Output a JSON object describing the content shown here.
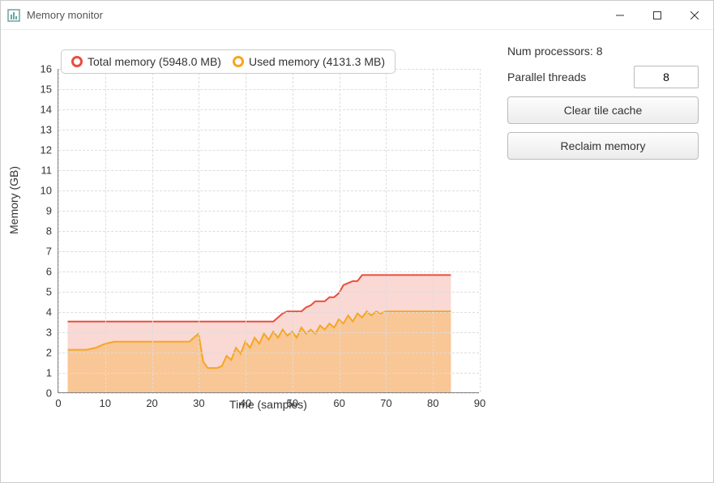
{
  "window": {
    "title": "Memory monitor"
  },
  "legend": {
    "total_label": "Total memory (5948.0 MB)",
    "used_label": "Used memory (4131.3 MB)"
  },
  "axes": {
    "ylabel": "Memory (GB)",
    "xlabel": "Time (samples)"
  },
  "side": {
    "num_processors_label": "Num processors: 8",
    "parallel_threads_label": "Parallel threads",
    "parallel_threads_value": "8",
    "clear_cache_label": "Clear tile cache",
    "reclaim_label": "Reclaim memory"
  },
  "chart_data": {
    "type": "area",
    "xlabel": "Time (samples)",
    "ylabel": "Memory (GB)",
    "xlim": [
      0,
      90
    ],
    "ylim": [
      0,
      16
    ],
    "xticks": [
      0,
      10,
      20,
      30,
      40,
      50,
      60,
      70,
      80,
      90
    ],
    "yticks": [
      0,
      1,
      2,
      3,
      4,
      5,
      6,
      7,
      8,
      9,
      10,
      11,
      12,
      13,
      14,
      15,
      16
    ],
    "x": [
      2,
      4,
      6,
      8,
      10,
      12,
      14,
      16,
      18,
      20,
      22,
      24,
      26,
      28,
      30,
      31,
      32,
      33,
      34,
      35,
      36,
      37,
      38,
      39,
      40,
      41,
      42,
      43,
      44,
      45,
      46,
      47,
      48,
      49,
      50,
      51,
      52,
      53,
      54,
      55,
      56,
      57,
      58,
      59,
      60,
      61,
      62,
      63,
      64,
      65,
      66,
      67,
      68,
      69,
      70,
      71,
      72,
      73,
      74,
      75,
      76,
      77,
      78,
      79,
      80,
      81,
      82,
      83,
      84
    ],
    "series": [
      {
        "name": "Total memory",
        "color": "#e94e3c",
        "values": [
          3.5,
          3.5,
          3.5,
          3.5,
          3.5,
          3.5,
          3.5,
          3.5,
          3.5,
          3.5,
          3.5,
          3.5,
          3.5,
          3.5,
          3.5,
          3.5,
          3.5,
          3.5,
          3.5,
          3.5,
          3.5,
          3.5,
          3.5,
          3.5,
          3.5,
          3.5,
          3.5,
          3.5,
          3.5,
          3.5,
          3.5,
          3.7,
          3.9,
          4.0,
          4.0,
          4.0,
          4.0,
          4.2,
          4.3,
          4.5,
          4.5,
          4.5,
          4.7,
          4.7,
          4.9,
          5.3,
          5.4,
          5.5,
          5.5,
          5.8,
          5.8,
          5.8,
          5.8,
          5.8,
          5.8,
          5.8,
          5.8,
          5.8,
          5.8,
          5.8,
          5.8,
          5.8,
          5.8,
          5.8,
          5.8,
          5.8,
          5.8,
          5.8,
          5.8
        ]
      },
      {
        "name": "Used memory",
        "color": "#f5a623",
        "values": [
          2.1,
          2.1,
          2.1,
          2.2,
          2.4,
          2.5,
          2.5,
          2.5,
          2.5,
          2.5,
          2.5,
          2.5,
          2.5,
          2.5,
          2.9,
          1.5,
          1.2,
          1.2,
          1.2,
          1.3,
          1.8,
          1.6,
          2.2,
          1.9,
          2.5,
          2.2,
          2.7,
          2.4,
          2.9,
          2.6,
          3.0,
          2.7,
          3.1,
          2.8,
          3.0,
          2.7,
          3.2,
          2.9,
          3.1,
          2.9,
          3.3,
          3.1,
          3.4,
          3.2,
          3.6,
          3.4,
          3.8,
          3.5,
          3.9,
          3.7,
          4.0,
          3.8,
          4.0,
          3.9,
          4.0,
          4.0,
          4.0,
          4.0,
          4.0,
          4.0,
          4.0,
          4.0,
          4.0,
          4.0,
          4.0,
          4.0,
          4.0,
          4.0,
          4.0
        ]
      }
    ]
  }
}
